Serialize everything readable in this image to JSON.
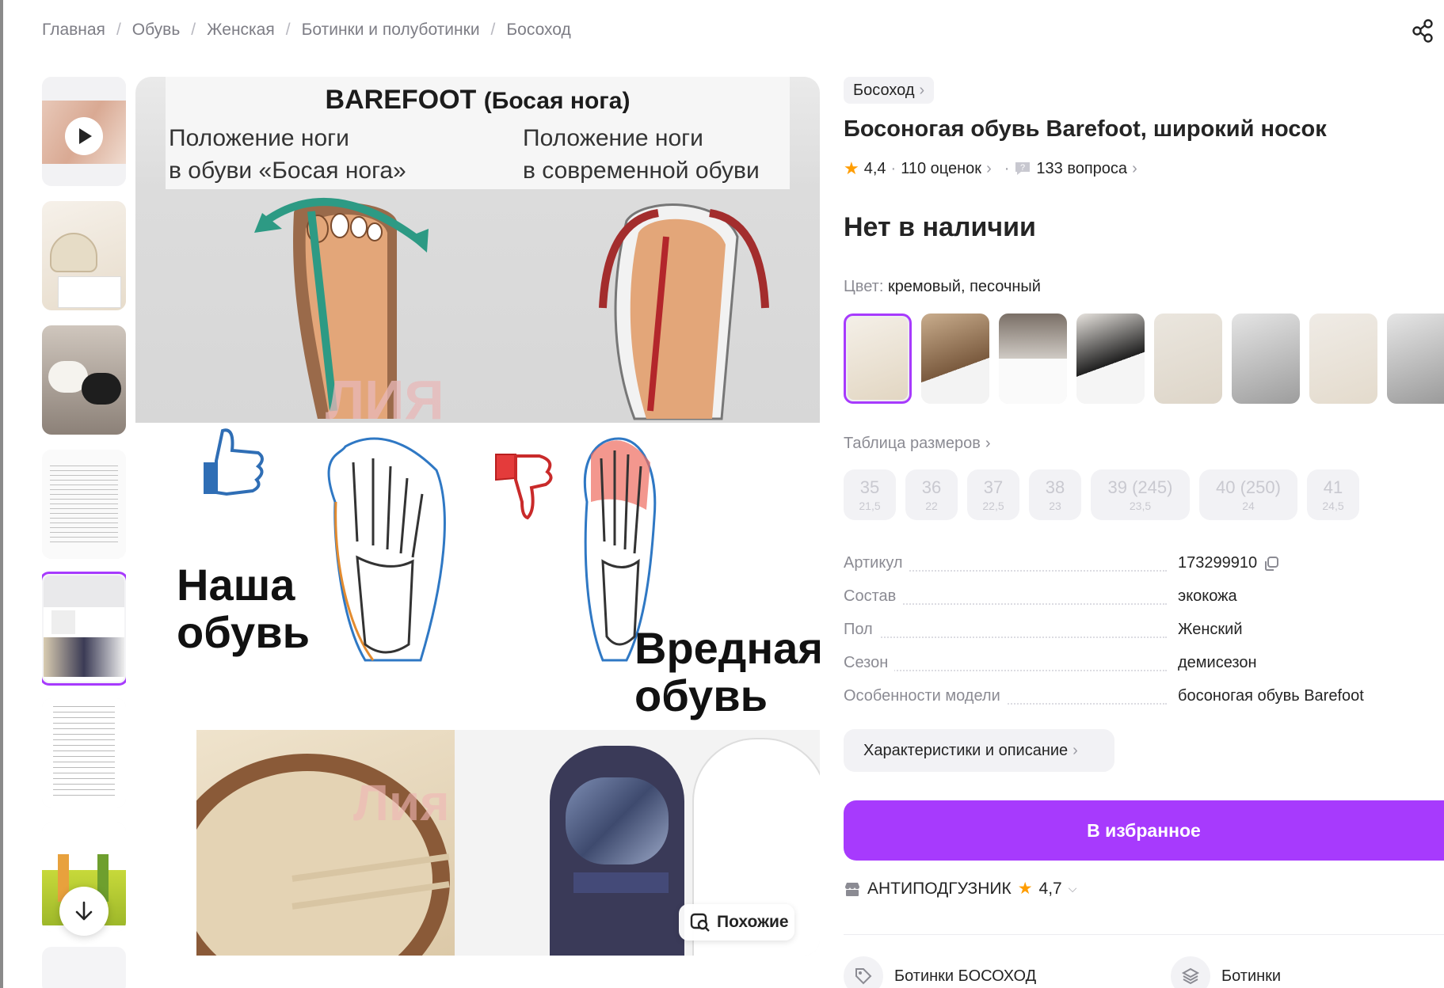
{
  "breadcrumb": [
    "Главная",
    "Обувь",
    "Женская",
    "Ботинки и полуботинки",
    "Босоход"
  ],
  "breadcrumb_separator": "/",
  "main_image": {
    "heading_bold": "BAREFOOT",
    "heading_sub": "(Босая нога)",
    "left_caption_1": "Положение ноги",
    "left_caption_2": "в обуви «Босая нога»",
    "right_caption_1": "Положение ноги",
    "right_caption_2": "в современной обуви",
    "good_1": "Наша",
    "good_2": "обувь",
    "bad_1": "Вредная",
    "bad_2": "обувь",
    "watermark": "Лия",
    "similar_label": "Похожие"
  },
  "product": {
    "brand": "Босоход",
    "title": "Босоногая обувь Barefoot, широкий носок",
    "rating": "4,4",
    "reviews": "110 оценок",
    "questions": "133 вопроса",
    "availability": "Нет в наличии",
    "color_label": "Цвет:",
    "color_value": "кремовый, песочный",
    "size_table": "Таблица размеров",
    "sizes": [
      {
        "main": "35",
        "sub": "21,5"
      },
      {
        "main": "36",
        "sub": "22"
      },
      {
        "main": "37",
        "sub": "22,5"
      },
      {
        "main": "38",
        "sub": "23"
      },
      {
        "main": "39 (245)",
        "sub": "23,5"
      },
      {
        "main": "40 (250)",
        "sub": "24"
      },
      {
        "main": "41",
        "sub": "24,5"
      }
    ],
    "specs": [
      {
        "key": "Артикул",
        "value": "173299910"
      },
      {
        "key": "Состав",
        "value": "экокожа"
      },
      {
        "key": "Пол",
        "value": "Женский"
      },
      {
        "key": "Сезон",
        "value": "демисезон"
      },
      {
        "key": "Особенности модели",
        "value": "босоногая обувь Barefoot"
      }
    ],
    "characteristics": "Характеристики и описание",
    "favorite_button": "В избранное",
    "seller_name": "АНТИПОДГУЗНИК",
    "seller_rating": "4,7",
    "tags": [
      "Ботинки БОСОХОД",
      "Ботинки"
    ]
  },
  "colors": {
    "accent": "#a73afd",
    "star": "#ff9d00",
    "muted": "#8b8b93"
  }
}
